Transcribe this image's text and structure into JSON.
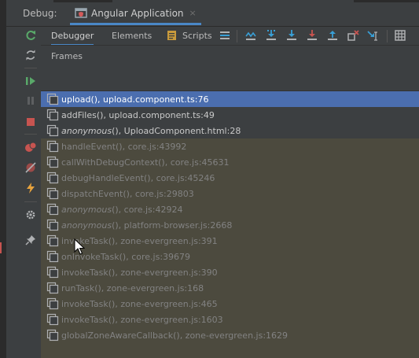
{
  "title_bar": {
    "debug_label": "Debug:",
    "run_config_name": "Angular Application",
    "close_glyph": "×"
  },
  "debug_tabs": [
    {
      "label": "Debugger",
      "active": true
    },
    {
      "label": "Elements",
      "active": false
    },
    {
      "label": "Scripts",
      "active": false
    }
  ],
  "step_toolbar_icons": [
    "restore-layout-icon",
    "show-execution-point-icon",
    "step-over-icon",
    "step-into-icon",
    "force-step-into-icon",
    "step-out-icon",
    "drop-frame-icon",
    "run-to-cursor-icon",
    "evaluate-expression-icon"
  ],
  "side_toolbar_icons": [
    "rerun-icon",
    "refresh-icon",
    "resume-icon",
    "pause-icon",
    "stop-icon",
    "view-breakpoints-icon",
    "mute-breakpoints-icon",
    "lightning-icon",
    "settings-icon",
    "pin-icon"
  ],
  "frames_panel": {
    "title": "Frames",
    "frames": [
      {
        "name": "upload()",
        "location": ", upload.component.ts:76",
        "italic": false,
        "state": "selected"
      },
      {
        "name": "addFiles()",
        "location": ", upload.component.ts:49",
        "italic": false,
        "state": "normal"
      },
      {
        "name": "anonymous",
        "location": "(), UploadComponent.html:28",
        "italic": true,
        "state": "normal"
      },
      {
        "name": "handleEvent()",
        "location": ", core.js:43992",
        "italic": false,
        "state": "library"
      },
      {
        "name": "callWithDebugContext()",
        "location": ", core.js:45631",
        "italic": false,
        "state": "library"
      },
      {
        "name": "debugHandleEvent()",
        "location": ", core.js:45246",
        "italic": false,
        "state": "library"
      },
      {
        "name": "dispatchEvent()",
        "location": ", core.js:29803",
        "italic": false,
        "state": "library"
      },
      {
        "name": "anonymous",
        "location": "(), core.js:42924",
        "italic": true,
        "state": "library"
      },
      {
        "name": "anonymous",
        "location": "(), platform-browser.js:2668",
        "italic": true,
        "state": "library"
      },
      {
        "name": "invokeTask()",
        "location": ", zone-evergreen.js:391",
        "italic": false,
        "state": "library"
      },
      {
        "name": "onInvokeTask()",
        "location": ", core.js:39679",
        "italic": false,
        "state": "library"
      },
      {
        "name": "invokeTask()",
        "location": ", zone-evergreen.js:390",
        "italic": false,
        "state": "library"
      },
      {
        "name": "runTask()",
        "location": ", zone-evergreen.js:168",
        "italic": false,
        "state": "library"
      },
      {
        "name": "invokeTask()",
        "location": ", zone-evergreen.js:465",
        "italic": false,
        "state": "library"
      },
      {
        "name": "invokeTask()",
        "location": ", zone-evergreen.js:1603",
        "italic": false,
        "state": "library"
      },
      {
        "name": "globalZoneAwareCallback()",
        "location": ", zone-evergreen.js:1629",
        "italic": false,
        "state": "library"
      }
    ]
  },
  "colors": {
    "background": "#3c3f41",
    "selected_row": "#4b6eaf",
    "library_row": "#4c4a3e",
    "tab_underline": "#4a88c7",
    "stop_red": "#c75450",
    "resume_green": "#59a869",
    "step_blue": "#389fd6"
  }
}
